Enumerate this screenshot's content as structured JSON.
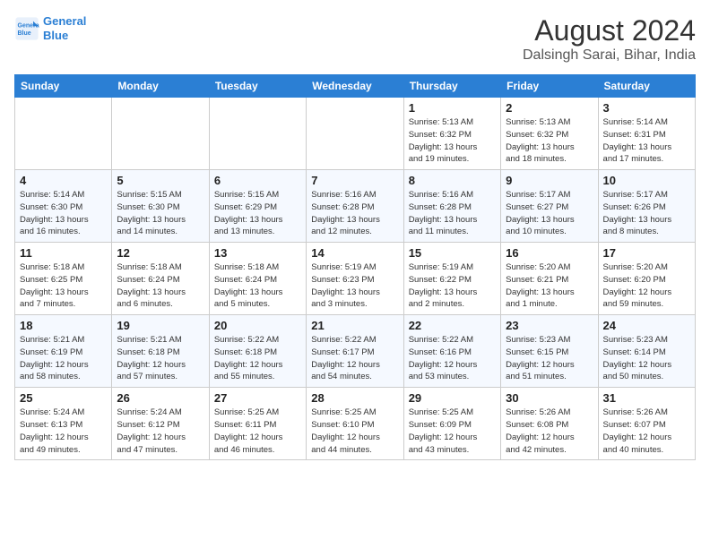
{
  "header": {
    "logo_line1": "General",
    "logo_line2": "Blue",
    "month": "August 2024",
    "location": "Dalsingh Sarai, Bihar, India"
  },
  "weekdays": [
    "Sunday",
    "Monday",
    "Tuesday",
    "Wednesday",
    "Thursday",
    "Friday",
    "Saturday"
  ],
  "weeks": [
    [
      {
        "day": "",
        "info": ""
      },
      {
        "day": "",
        "info": ""
      },
      {
        "day": "",
        "info": ""
      },
      {
        "day": "",
        "info": ""
      },
      {
        "day": "1",
        "info": "Sunrise: 5:13 AM\nSunset: 6:32 PM\nDaylight: 13 hours\nand 19 minutes."
      },
      {
        "day": "2",
        "info": "Sunrise: 5:13 AM\nSunset: 6:32 PM\nDaylight: 13 hours\nand 18 minutes."
      },
      {
        "day": "3",
        "info": "Sunrise: 5:14 AM\nSunset: 6:31 PM\nDaylight: 13 hours\nand 17 minutes."
      }
    ],
    [
      {
        "day": "4",
        "info": "Sunrise: 5:14 AM\nSunset: 6:30 PM\nDaylight: 13 hours\nand 16 minutes."
      },
      {
        "day": "5",
        "info": "Sunrise: 5:15 AM\nSunset: 6:30 PM\nDaylight: 13 hours\nand 14 minutes."
      },
      {
        "day": "6",
        "info": "Sunrise: 5:15 AM\nSunset: 6:29 PM\nDaylight: 13 hours\nand 13 minutes."
      },
      {
        "day": "7",
        "info": "Sunrise: 5:16 AM\nSunset: 6:28 PM\nDaylight: 13 hours\nand 12 minutes."
      },
      {
        "day": "8",
        "info": "Sunrise: 5:16 AM\nSunset: 6:28 PM\nDaylight: 13 hours\nand 11 minutes."
      },
      {
        "day": "9",
        "info": "Sunrise: 5:17 AM\nSunset: 6:27 PM\nDaylight: 13 hours\nand 10 minutes."
      },
      {
        "day": "10",
        "info": "Sunrise: 5:17 AM\nSunset: 6:26 PM\nDaylight: 13 hours\nand 8 minutes."
      }
    ],
    [
      {
        "day": "11",
        "info": "Sunrise: 5:18 AM\nSunset: 6:25 PM\nDaylight: 13 hours\nand 7 minutes."
      },
      {
        "day": "12",
        "info": "Sunrise: 5:18 AM\nSunset: 6:24 PM\nDaylight: 13 hours\nand 6 minutes."
      },
      {
        "day": "13",
        "info": "Sunrise: 5:18 AM\nSunset: 6:24 PM\nDaylight: 13 hours\nand 5 minutes."
      },
      {
        "day": "14",
        "info": "Sunrise: 5:19 AM\nSunset: 6:23 PM\nDaylight: 13 hours\nand 3 minutes."
      },
      {
        "day": "15",
        "info": "Sunrise: 5:19 AM\nSunset: 6:22 PM\nDaylight: 13 hours\nand 2 minutes."
      },
      {
        "day": "16",
        "info": "Sunrise: 5:20 AM\nSunset: 6:21 PM\nDaylight: 13 hours\nand 1 minute."
      },
      {
        "day": "17",
        "info": "Sunrise: 5:20 AM\nSunset: 6:20 PM\nDaylight: 12 hours\nand 59 minutes."
      }
    ],
    [
      {
        "day": "18",
        "info": "Sunrise: 5:21 AM\nSunset: 6:19 PM\nDaylight: 12 hours\nand 58 minutes."
      },
      {
        "day": "19",
        "info": "Sunrise: 5:21 AM\nSunset: 6:18 PM\nDaylight: 12 hours\nand 57 minutes."
      },
      {
        "day": "20",
        "info": "Sunrise: 5:22 AM\nSunset: 6:18 PM\nDaylight: 12 hours\nand 55 minutes."
      },
      {
        "day": "21",
        "info": "Sunrise: 5:22 AM\nSunset: 6:17 PM\nDaylight: 12 hours\nand 54 minutes."
      },
      {
        "day": "22",
        "info": "Sunrise: 5:22 AM\nSunset: 6:16 PM\nDaylight: 12 hours\nand 53 minutes."
      },
      {
        "day": "23",
        "info": "Sunrise: 5:23 AM\nSunset: 6:15 PM\nDaylight: 12 hours\nand 51 minutes."
      },
      {
        "day": "24",
        "info": "Sunrise: 5:23 AM\nSunset: 6:14 PM\nDaylight: 12 hours\nand 50 minutes."
      }
    ],
    [
      {
        "day": "25",
        "info": "Sunrise: 5:24 AM\nSunset: 6:13 PM\nDaylight: 12 hours\nand 49 minutes."
      },
      {
        "day": "26",
        "info": "Sunrise: 5:24 AM\nSunset: 6:12 PM\nDaylight: 12 hours\nand 47 minutes."
      },
      {
        "day": "27",
        "info": "Sunrise: 5:25 AM\nSunset: 6:11 PM\nDaylight: 12 hours\nand 46 minutes."
      },
      {
        "day": "28",
        "info": "Sunrise: 5:25 AM\nSunset: 6:10 PM\nDaylight: 12 hours\nand 44 minutes."
      },
      {
        "day": "29",
        "info": "Sunrise: 5:25 AM\nSunset: 6:09 PM\nDaylight: 12 hours\nand 43 minutes."
      },
      {
        "day": "30",
        "info": "Sunrise: 5:26 AM\nSunset: 6:08 PM\nDaylight: 12 hours\nand 42 minutes."
      },
      {
        "day": "31",
        "info": "Sunrise: 5:26 AM\nSunset: 6:07 PM\nDaylight: 12 hours\nand 40 minutes."
      }
    ]
  ]
}
